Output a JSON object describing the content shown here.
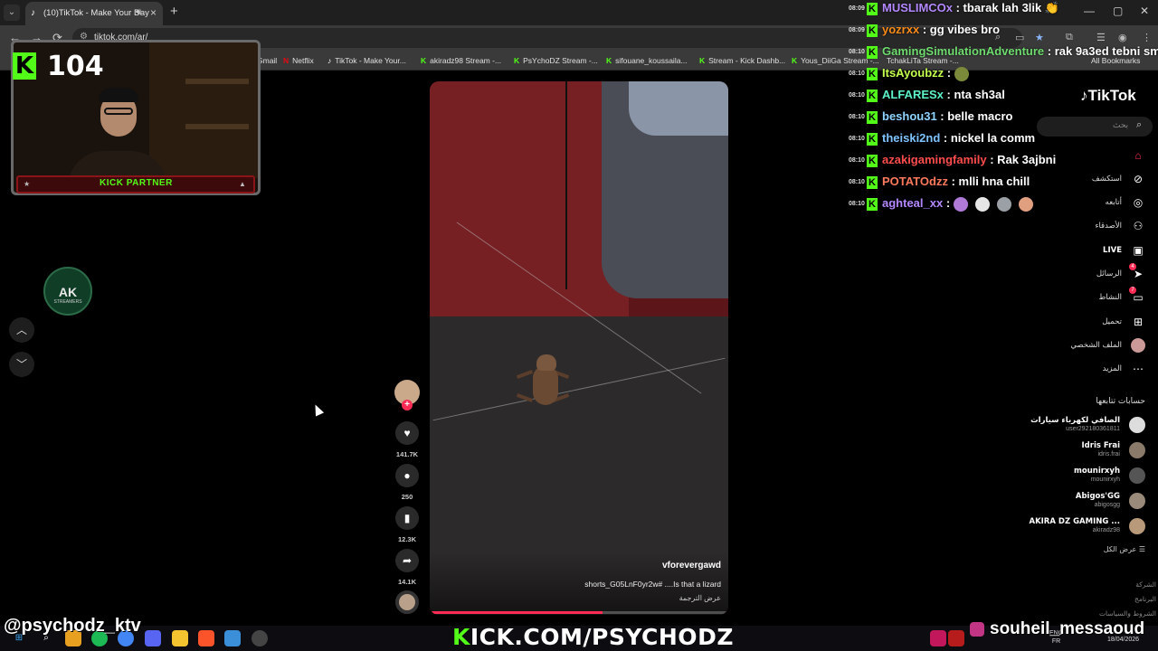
{
  "browser": {
    "tab_title": "(10)TikTok - Make Your Day",
    "url": "tiktok.com/ar/",
    "bookmarks": [
      "Gmail",
      "Netflix",
      "TikTok - Make Your...",
      "akiradz98 Stream -...",
      "PsYchoDZ Stream -...",
      "sifouane_koussaila...",
      "Stream - Kick Dashb...",
      "Yous_DiiGa Stream -...",
      "TchakLiTa Stream -...",
      "All Bookmarks"
    ]
  },
  "stream": {
    "viewer_count": "104",
    "partner_label": "KICK PARTNER",
    "logo_text": "AK",
    "logo_sub": "STREAMERS"
  },
  "chat": [
    {
      "time": "08:09",
      "user": "MUSLIMCOx",
      "text": " : tbarak lah 3lik 👏",
      "color": "#b388ff"
    },
    {
      "time": "08:09",
      "user": "yozrxx",
      "text": " : gg vibes bro",
      "color": "#ff8c1a"
    },
    {
      "time": "08:10",
      "user": "GamingSimulationAdventure",
      "text": " : rak 9a3ed tebni smiy",
      "color": "#6fdc6f"
    },
    {
      "time": "08:10",
      "user": "ItsAyoubzz",
      "text": " : ",
      "color": "#c4ff4d"
    },
    {
      "time": "08:10",
      "user": "ALFARESx",
      "text": " : nta sh3al",
      "color": "#5cf2c9"
    },
    {
      "time": "08:10",
      "user": "beshou31",
      "text": " : belle macro",
      "color": "#8fd3ff"
    },
    {
      "time": "08:10",
      "user": "theiski2nd",
      "text": " : nickel la comm",
      "color": "#7ec3ff"
    },
    {
      "time": "08:10",
      "user": "azakigamingfamily",
      "text": " : Rak 3ajbni",
      "color": "#ff4d4d"
    },
    {
      "time": "08:10",
      "user": "POTATOdzz",
      "text": " : mlli hna chill",
      "color": "#ff7a5c"
    },
    {
      "time": "08:10",
      "user": "aghteal_xx",
      "text": " : ",
      "color": "#b388ff"
    }
  ],
  "video": {
    "username": "vforevergawd",
    "caption": "shorts_G05LnF0yr2w# ....Is that a lizard",
    "translate": "عرض الترجمة",
    "progress": 0.58,
    "likes": "141.7K",
    "comments": "250",
    "saves": "12.3K",
    "shares": "14.1K"
  },
  "tiktok": {
    "logo": "TikTok",
    "search_placeholder": "بحث",
    "nav": [
      {
        "label": "",
        "icon": "home-icon"
      },
      {
        "label": "استكشف",
        "icon": "compass-icon"
      },
      {
        "label": "أتابعه",
        "icon": "following-icon"
      },
      {
        "label": "الأصدقاء",
        "icon": "friends-icon"
      },
      {
        "label": "LIVE",
        "icon": "live-icon"
      },
      {
        "label": "الرسائل",
        "icon": "messages-icon",
        "badge": "4"
      },
      {
        "label": "النشاط",
        "icon": "activity-icon",
        "badge": "7"
      },
      {
        "label": "تحميل",
        "icon": "upload-icon"
      },
      {
        "label": "الملف الشخصي",
        "icon": "profile-icon"
      },
      {
        "label": "المزيد",
        "icon": "more-icon"
      }
    ],
    "following_title": "حسابات تتابعها",
    "following": [
      {
        "name": "الصافي لكهرباء سيارات",
        "handle": "user292180361811"
      },
      {
        "name": "Idris Frai",
        "handle": "idris.frai"
      },
      {
        "name": "mounirxyh",
        "handle": "mounirxyh"
      },
      {
        "name": "Abigos'GG",
        "handle": "abigosgg"
      },
      {
        "name": "AKIRA DZ GAMING ...",
        "handle": "akiradz98"
      }
    ],
    "see_all": "عرض الكل",
    "footer": [
      "الشركة",
      "البرنامج",
      "الشروط والسياسات"
    ]
  },
  "overlay": {
    "handle_left": "@psychodz_ktv",
    "kick_url_k": "K",
    "kick_url_rest": "ICK.COM/PSYCHODZ",
    "handle_right": "souheil_messaoud"
  },
  "taskbar": {
    "lang_top": "ENG",
    "lang_bottom": "FR",
    "date": "18/04/2026"
  },
  "colors": {
    "kick_green": "#53fc18",
    "tiktok_red": "#fe2c55"
  }
}
